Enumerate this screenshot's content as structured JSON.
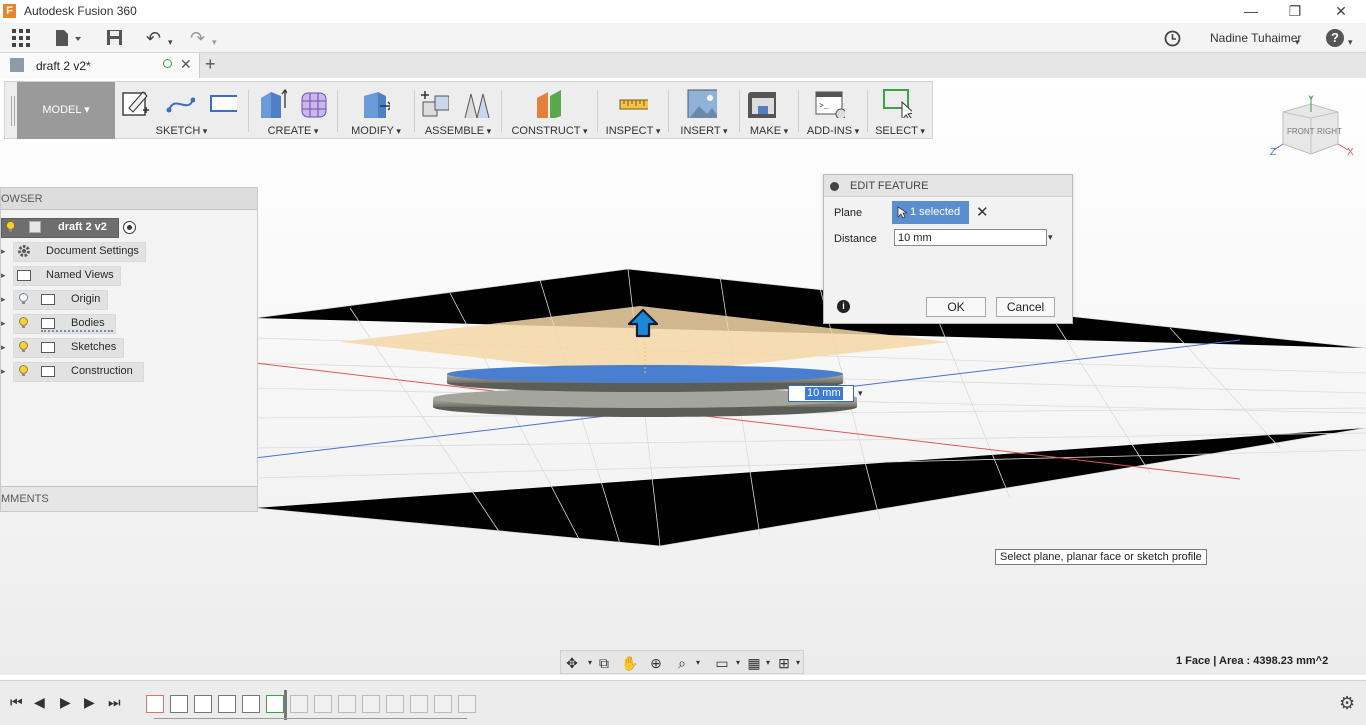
{
  "app": {
    "title": "Autodesk Fusion 360",
    "logo_letter": "F",
    "window_controls": [
      "—",
      "❐",
      "✕"
    ]
  },
  "quick_access": {
    "user": "Nadine Tuhaimer",
    "help": "?",
    "undo": "↶",
    "redo": "↷",
    "history_icon": "clock-icon"
  },
  "tab": {
    "name": "draft 2 v2*",
    "close": "✕",
    "add": "+"
  },
  "toolbar": {
    "workspace": "MODEL ▾",
    "groups": [
      "SKETCH",
      "CREATE",
      "MODIFY",
      "ASSEMBLE",
      "CONSTRUCT",
      "INSPECT",
      "INSERT",
      "MAKE",
      "ADD-INS",
      "SELECT"
    ]
  },
  "viewcube": {
    "front": "FRONT",
    "right": "RIGHT",
    "axis_x": "X",
    "axis_y": "Y",
    "axis_z": "Z"
  },
  "browser": {
    "header": "OWSER",
    "root": "draft 2 v2",
    "items": [
      {
        "label": "Document Settings",
        "icon": "gear-icon"
      },
      {
        "label": "Named Views",
        "icon": "folder-icon"
      },
      {
        "label": "Origin",
        "icon": "folder-icon"
      },
      {
        "label": "Bodies",
        "icon": "folder-icon"
      },
      {
        "label": "Sketches",
        "icon": "folder-icon"
      },
      {
        "label": "Construction",
        "icon": "folder-icon"
      }
    ],
    "comments": "MMENTS"
  },
  "dialog": {
    "title": "EDIT FEATURE",
    "plane_label": "Plane",
    "plane_value": "1 selected",
    "clear": "✕",
    "distance_label": "Distance",
    "distance_value": "10 mm",
    "ok": "OK",
    "cancel": "Cancel",
    "info": "i"
  },
  "canvas_input": {
    "value": "10 mm"
  },
  "hint": "Select plane, planar face or sketch profile",
  "status": {
    "measure": "1 Face | Area : 4398.23 mm^2"
  },
  "colors": {
    "plane_fill": "#f6d7a6",
    "selected_face": "#4a7fd0",
    "body": "#8e8e86",
    "arrow": "#1e88d8",
    "axis_red": "#e05656",
    "axis_blue": "#4a6fe0"
  }
}
